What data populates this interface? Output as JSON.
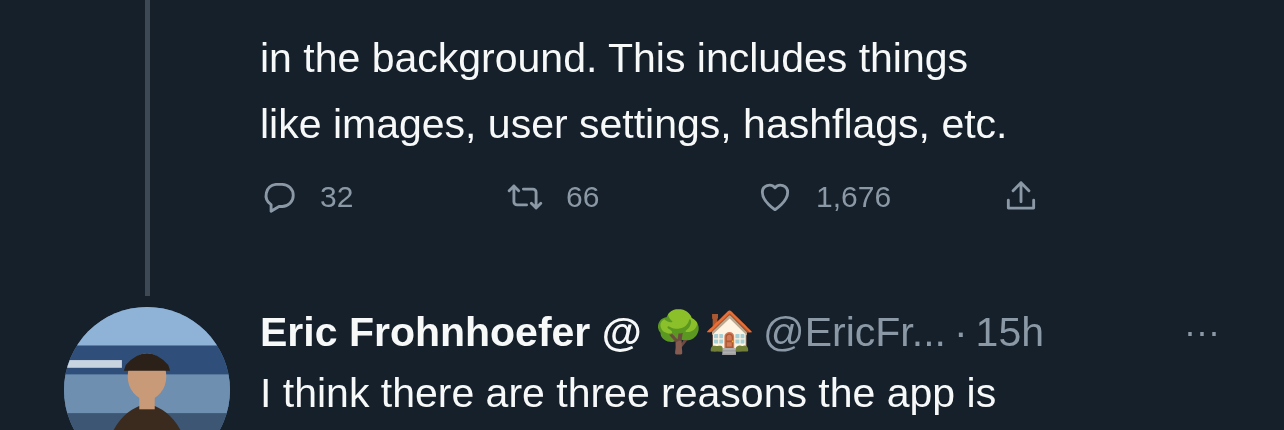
{
  "thread": {
    "text_lines": [
      "in the background. This includes things",
      "like images, user settings, hashflags, etc."
    ],
    "actions": [
      {
        "kind": "reply",
        "count": "32"
      },
      {
        "kind": "retweet",
        "count": "66"
      },
      {
        "kind": "like",
        "count": "1,676"
      },
      {
        "kind": "share"
      }
    ]
  },
  "reply": {
    "name": "Eric Frohnhoefer @ 🌳🏠",
    "handle": "@EricFr...",
    "separator": "·",
    "time": "15h",
    "more": "···",
    "text": "I think there are three reasons the app is"
  }
}
